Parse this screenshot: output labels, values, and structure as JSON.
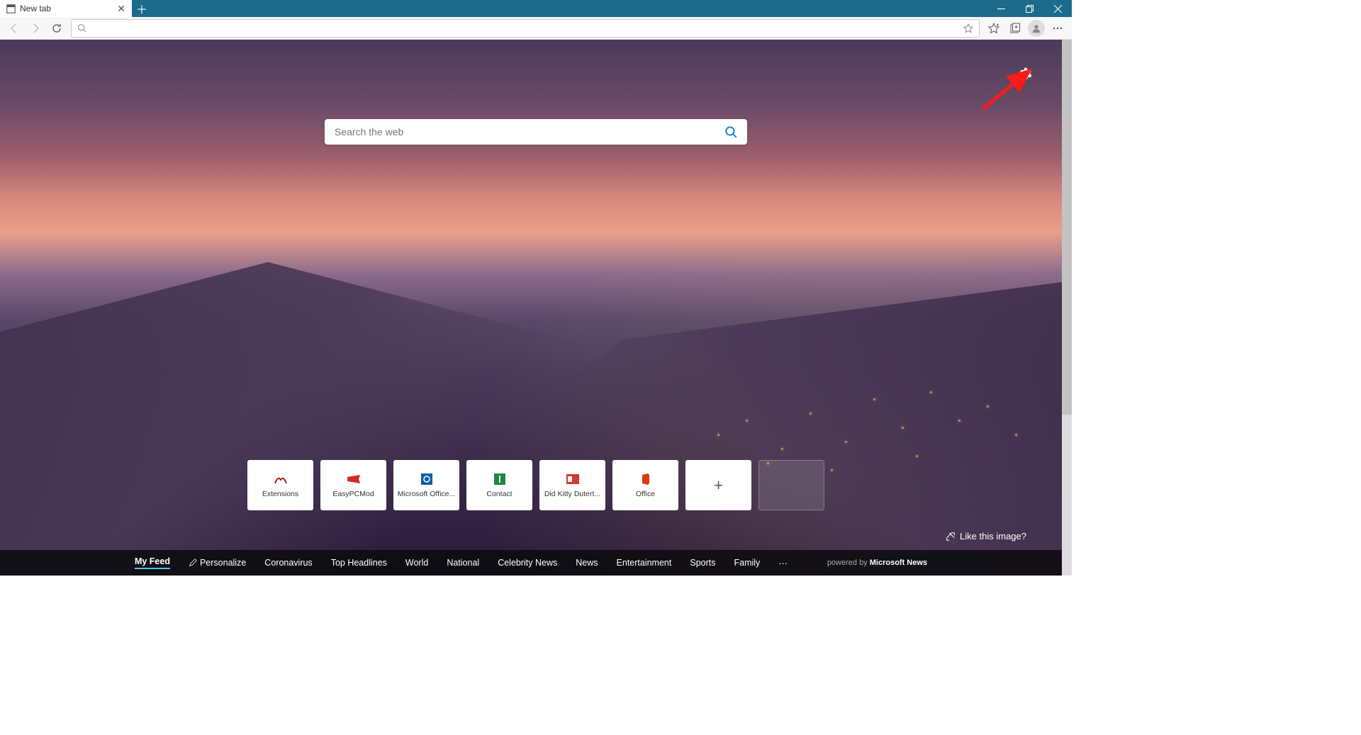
{
  "tab": {
    "title": "New tab"
  },
  "addressbar": {
    "value": ""
  },
  "search": {
    "placeholder": "Search the web"
  },
  "tiles": [
    {
      "label": "Extensions",
      "color": "#b01b1b",
      "shape": "ext"
    },
    {
      "label": "EasyPCMod",
      "color": "#d42a2a",
      "shape": "flag"
    },
    {
      "label": "Microsoft Office...",
      "color": "#0a5ea8",
      "shape": "square-o"
    },
    {
      "label": "Contact",
      "color": "#1a8a3a",
      "shape": "square-i"
    },
    {
      "label": "Did Kitty Dutert...",
      "color": "#d43a2a",
      "shape": "outlook"
    },
    {
      "label": "Office",
      "color": "#d83b01",
      "shape": "office"
    }
  ],
  "like_image": "Like this image?",
  "feed": {
    "items": [
      "My Feed",
      "Personalize",
      "Coronavirus",
      "Top Headlines",
      "World",
      "National",
      "Celebrity News",
      "News",
      "Entertainment",
      "Sports",
      "Family"
    ],
    "active": "My Feed",
    "powered_prefix": "powered by",
    "powered_brand": "Microsoft News"
  }
}
